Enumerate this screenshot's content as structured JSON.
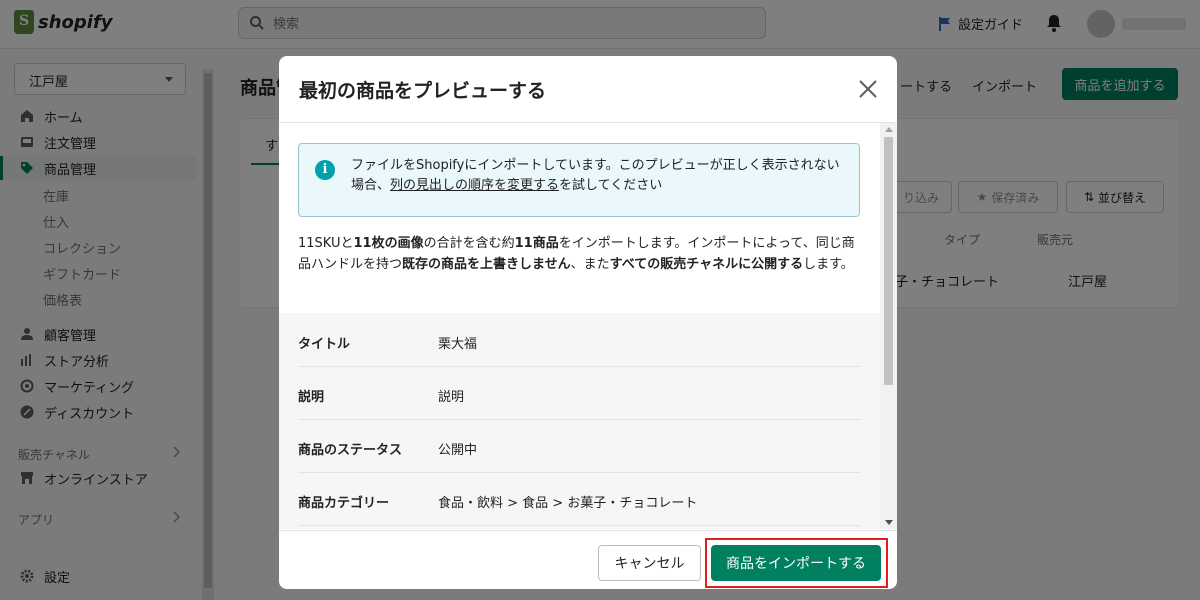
{
  "app": {
    "logo_text": "shopify",
    "brand_color": "#008060"
  },
  "topbar": {
    "search_placeholder": "検索",
    "setup_guide": "設定ガイド"
  },
  "sidebar": {
    "store_name": "江戸屋",
    "items": [
      {
        "label": "ホーム",
        "icon": "home-icon"
      },
      {
        "label": "注文管理",
        "icon": "inbox-icon"
      },
      {
        "label": "商品管理",
        "icon": "tag-icon",
        "active": true
      }
    ],
    "sub_items": [
      "在庫",
      "仕入",
      "コレクション",
      "ギフトカード",
      "価格表"
    ],
    "items2": [
      {
        "label": "顧客管理",
        "icon": "person-icon"
      },
      {
        "label": "ストア分析",
        "icon": "bar-chart-icon"
      },
      {
        "label": "マーケティング",
        "icon": "target-icon"
      },
      {
        "label": "ディスカウント",
        "icon": "discount-icon"
      }
    ],
    "sales_channels": "販売チャネル",
    "online_store": "オンラインストア",
    "apps": "アプリ",
    "settings": "設定"
  },
  "background": {
    "title": "商品管",
    "export": "ートする",
    "import": "インポート",
    "add_product": "商品を追加する",
    "tab_first": "す",
    "filter": "り込み",
    "saved": "保存済み",
    "sort": "並び替え",
    "col_type": "タイプ",
    "col_channel": "販売元",
    "cell_type": "子・チョコレート",
    "cell_channel": "江戸屋"
  },
  "modal": {
    "title": "最初の商品をプレビューする",
    "banner_text_1": "ファイルをShopifyにインポートしています。このプレビューが正しく表示されない場合、",
    "banner_link": "列の見出しの順序を変更する",
    "banner_text_2": "を試してください",
    "desc_1": "11SKUと",
    "desc_2": "11枚の画像",
    "desc_3": "の合計を含む約",
    "desc_4": "11商品",
    "desc_5": "をインポートします。インポートによって、同じ商品ハンドルを持つ",
    "desc_6": "既存の商品を上書きしません",
    "desc_7": "、また",
    "desc_8": "すべての販売チャネルに公開する",
    "desc_9": "します。",
    "rows": [
      {
        "key": "タイトル",
        "value": "栗大福"
      },
      {
        "key": "説明",
        "value": "説明"
      },
      {
        "key": "商品のステータス",
        "value": "公開中"
      },
      {
        "key": "商品カテゴリー",
        "value": "食品・飲料 > 食品 > お菓子・チョコレート"
      }
    ],
    "cancel": "キャンセル",
    "import": "商品をインポートする"
  }
}
